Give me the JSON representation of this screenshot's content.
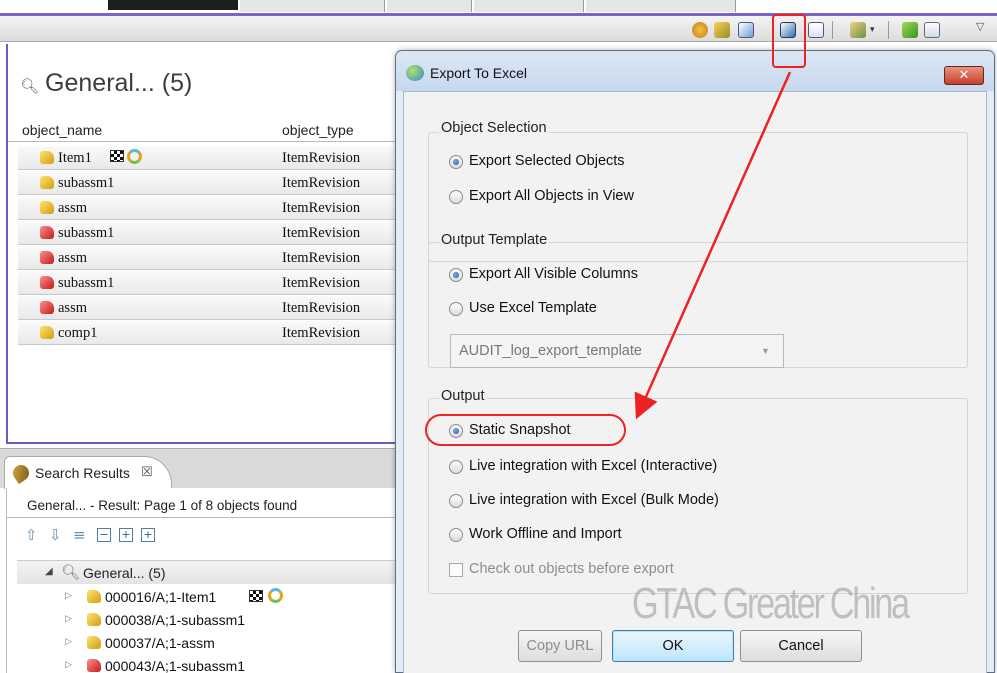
{
  "search_view": {
    "title": "General... (5)",
    "columns": [
      "object_name",
      "object_type"
    ],
    "rows": [
      {
        "name": "Item1",
        "type": "ItemRevision",
        "icon": "item-revision-yellow-icon"
      },
      {
        "name": "subassm1",
        "type": "ItemRevision",
        "icon": "item-revision-yellow-icon"
      },
      {
        "name": "assm",
        "type": "ItemRevision",
        "icon": "item-revision-yellow-icon"
      },
      {
        "name": "subassm1",
        "type": "ItemRevision",
        "icon": "item-revision-red-icon"
      },
      {
        "name": "assm",
        "type": "ItemRevision",
        "icon": "item-revision-red-icon"
      },
      {
        "name": "subassm1",
        "type": "ItemRevision",
        "icon": "item-revision-red-icon"
      },
      {
        "name": "assm",
        "type": "ItemRevision",
        "icon": "item-revision-red-icon"
      },
      {
        "name": "comp1",
        "type": "ItemRevision",
        "icon": "item-revision-yellow-icon"
      }
    ]
  },
  "search_results": {
    "tab_label": "Search Results",
    "status": "General... - Result: Page 1 of 8 objects found",
    "root_label": "General... (5)",
    "tree_items": [
      {
        "label": "000016/A;1-Item1"
      },
      {
        "label": "000038/A;1-subassm1"
      },
      {
        "label": "000037/A;1-assm"
      },
      {
        "label": "000043/A;1-subassm1"
      }
    ]
  },
  "dialog": {
    "title": "Export To Excel",
    "object_selection": {
      "title": "Object Selection",
      "options": [
        "Export Selected Objects",
        "Export All Objects in View"
      ],
      "selected": 0
    },
    "output_template": {
      "title": "Output Template",
      "options": [
        "Export All Visible Columns",
        "Use Excel Template"
      ],
      "selected": 0,
      "template_value": "AUDIT_log_export_template"
    },
    "output": {
      "title": "Output",
      "options": [
        "Static Snapshot",
        "Live integration with Excel (Interactive)",
        "Live integration with Excel (Bulk Mode)",
        "Work Offline and Import"
      ],
      "selected": 0,
      "checkout_label": "Check out objects before export",
      "checkout_checked": false
    },
    "buttons": {
      "copy_url": "Copy URL",
      "ok": "OK",
      "cancel": "Cancel"
    }
  },
  "watermark": "GTAC Greater China",
  "colors": {
    "accent_purple": "#7058c2",
    "annotation_red": "#ee2222",
    "dialog_frame": "#e3ecf7"
  }
}
